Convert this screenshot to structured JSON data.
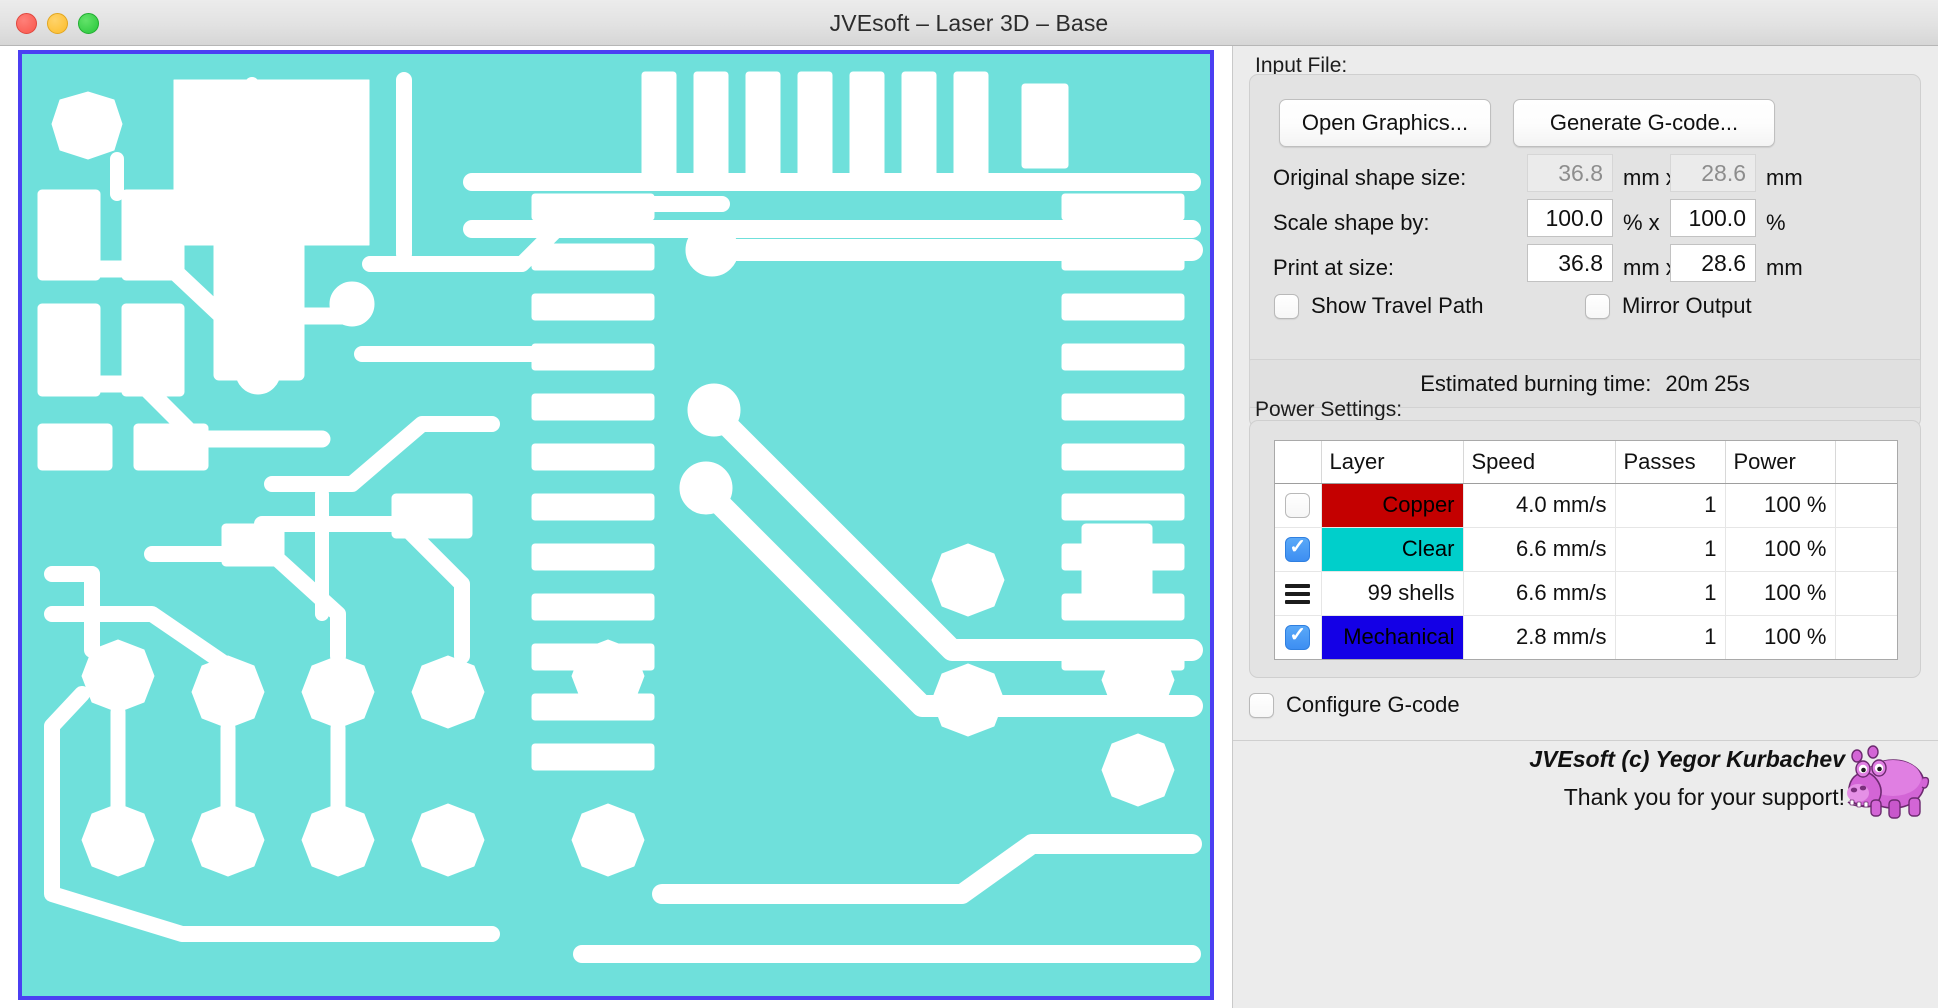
{
  "window": {
    "title": "JVEsoft – Laser 3D – Base",
    "traffic_lights": [
      "close-button",
      "minimize-button",
      "maximize-button"
    ]
  },
  "canvas": {
    "name": "pcb-preview",
    "fill_color": "#6FE0DB",
    "border_color": "#4b3ff2",
    "background": "#ffffff"
  },
  "input_file": {
    "group_label": "Input File:",
    "open_button": "Open Graphics...",
    "generate_button": "Generate G-code...",
    "original_shape_label": "Original shape size:",
    "original_width": "36.8",
    "original_height": "28.6",
    "scale_label": "Scale shape by:",
    "scale_x": "100.0",
    "scale_y": "100.0",
    "print_label": "Print at size:",
    "print_width": "36.8",
    "print_height": "28.6",
    "unit_mm": "mm",
    "unit_mm_x": "mm x",
    "unit_percent": "%",
    "unit_percent_x": "%  x",
    "show_travel_path": "Show Travel Path",
    "show_travel_path_checked": false,
    "mirror_output": "Mirror Output",
    "mirror_output_checked": false
  },
  "estimate": {
    "label": "Estimated burning time:",
    "value": "20m 25s"
  },
  "power_settings": {
    "group_label": "Power Settings:",
    "columns": [
      "",
      "Layer",
      "Speed",
      "Passes",
      "Power",
      ""
    ],
    "rows": [
      {
        "enabled": "unchecked",
        "layer": "Copper",
        "layer_color": "#C40000",
        "layer_text_color": "#000000",
        "speed": "4.0 mm/s",
        "passes": "1",
        "power": "100 %"
      },
      {
        "enabled": "checked",
        "layer": "Clear",
        "layer_color": "#00CFCB",
        "layer_text_color": "#000000",
        "speed": "6.6 mm/s",
        "passes": "1",
        "power": "100 %"
      },
      {
        "enabled": "mixed",
        "layer": "99 shells",
        "layer_color": "#ffffff",
        "layer_text_color": "#111111",
        "speed": "6.6 mm/s",
        "passes": "1",
        "power": "100 %"
      },
      {
        "enabled": "checked",
        "layer": "Mechanical",
        "layer_color": "#1400E6",
        "layer_text_color": "#000000",
        "speed": "2.8 mm/s",
        "passes": "1",
        "power": "100 %"
      }
    ]
  },
  "configure": {
    "label": "Configure G-code",
    "checked": false
  },
  "footer": {
    "copyright": "JVEsoft (c) Yegor Kurbachev",
    "thanks": "Thank you for your support!",
    "mascot": "hippo-mascot"
  }
}
